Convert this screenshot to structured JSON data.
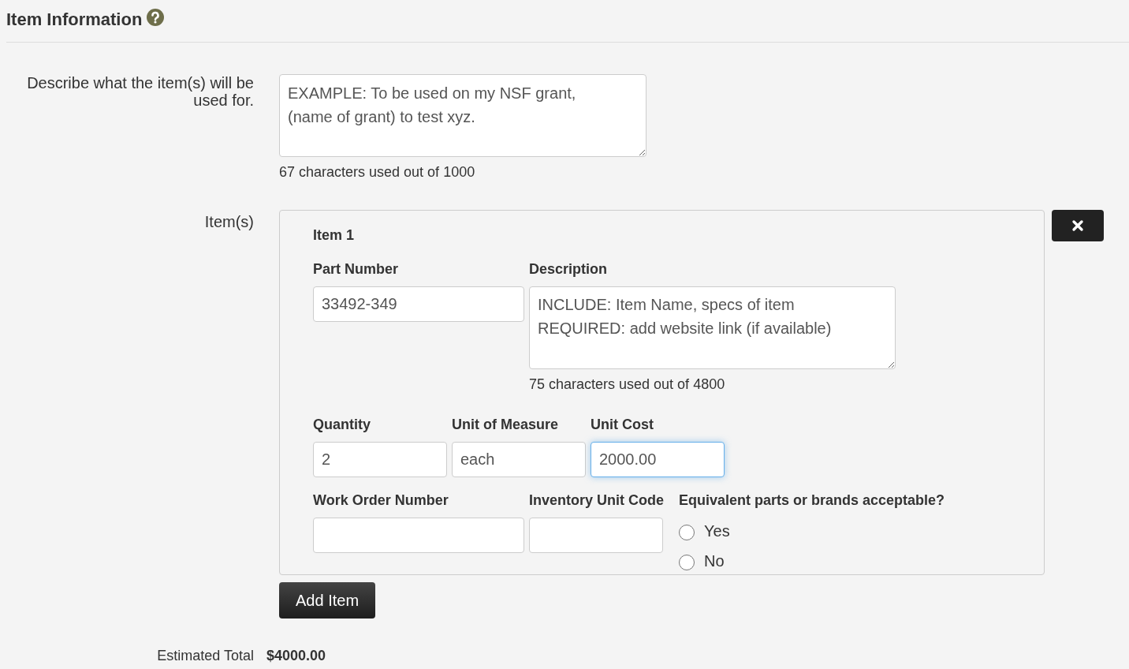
{
  "section": {
    "title": "Item Information"
  },
  "purpose": {
    "label": "Describe what the item(s) will be used for.",
    "value": "EXAMPLE: To be used on my NSF grant,\n(name of grant) to test xyz.",
    "counter": "67 characters used out of 1000"
  },
  "items_label": "Item(s)",
  "items": [
    {
      "title": "Item 1",
      "part_number": {
        "label": "Part Number",
        "value": "33492-349"
      },
      "description": {
        "label": "Description",
        "value": "INCLUDE: Item Name, specs of item\nREQUIRED: add website link (if available)",
        "counter": "75 characters used out of 4800"
      },
      "quantity": {
        "label": "Quantity",
        "value": "2",
        "focused": false
      },
      "unit_of_measure": {
        "label": "Unit of Measure",
        "value": "each",
        "focused": false
      },
      "unit_cost": {
        "label": "Unit Cost",
        "value": "2000.00",
        "focused": true
      },
      "work_order": {
        "label": "Work Order Number"
      },
      "inventory_code": {
        "label": "Inventory Unit Code"
      },
      "equivalent": {
        "label": "Equivalent parts or brands acceptable?",
        "options": [
          {
            "label": "Yes",
            "selected": false
          },
          {
            "label": "No",
            "selected": false
          }
        ]
      }
    }
  ],
  "add_button": "Add Item",
  "total": {
    "label": "Estimated Total",
    "value": "$4000.00"
  }
}
